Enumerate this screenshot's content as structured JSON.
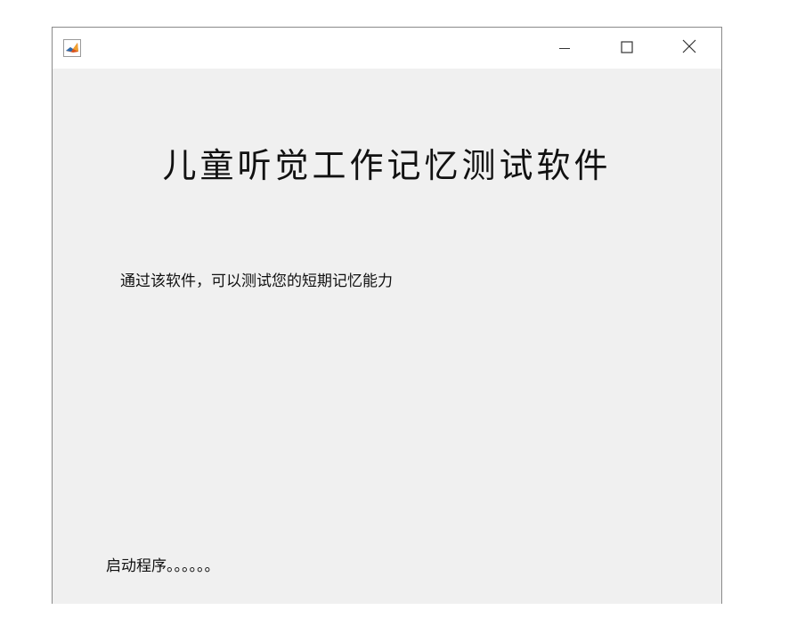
{
  "window": {
    "accent_color": "#f0f0f0",
    "title_bar_color": "#ffffff",
    "app_icon": "matlab-membrane-icon",
    "controls": {
      "minimize_icon": "minimize-icon",
      "maximize_icon": "maximize-icon",
      "close_icon": "close-icon"
    }
  },
  "main": {
    "title": "儿童听觉工作记忆测试软件",
    "description": "通过该软件，可以测试您的短期记忆能力",
    "status": "启动程序。。。。。。"
  }
}
